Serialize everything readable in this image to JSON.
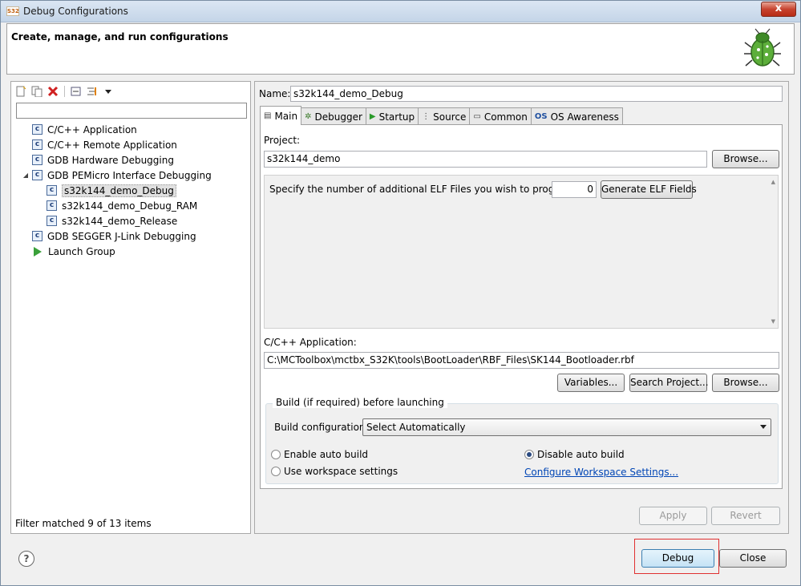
{
  "window": {
    "title": "Debug Configurations",
    "close_glyph": "x"
  },
  "header": {
    "title": "Create, manage, and run configurations"
  },
  "left_panel": {
    "filter_placeholder": "",
    "tree": [
      {
        "label": "C/C++ Application",
        "icon": "c-config-icon",
        "level": 1,
        "expanded": null
      },
      {
        "label": "C/C++ Remote Application",
        "icon": "c-config-icon",
        "level": 1,
        "expanded": null
      },
      {
        "label": "GDB Hardware Debugging",
        "icon": "c-config-icon",
        "level": 1,
        "expanded": null
      },
      {
        "label": "GDB PEMicro Interface Debugging",
        "icon": "c-config-icon",
        "level": 1,
        "expanded": true
      },
      {
        "label": "s32k144_demo_Debug",
        "icon": "c-config-icon",
        "level": 2,
        "selected": true
      },
      {
        "label": "s32k144_demo_Debug_RAM",
        "icon": "c-config-icon",
        "level": 2
      },
      {
        "label": "s32k144_demo_Release",
        "icon": "c-config-icon",
        "level": 2
      },
      {
        "label": "GDB SEGGER J-Link Debugging",
        "icon": "c-config-icon",
        "level": 1
      },
      {
        "label": "Launch Group",
        "icon": "launch-group-icon",
        "level": 1
      }
    ],
    "filter_status": "Filter matched 9 of 13 items"
  },
  "right_panel": {
    "name_label": "Name:",
    "name_value": "s32k144_demo_Debug",
    "tabs": [
      {
        "label": "Main",
        "icon": "main-tab-icon",
        "active": true
      },
      {
        "label": "Debugger",
        "icon": "debugger-tab-icon"
      },
      {
        "label": "Startup",
        "icon": "startup-tab-icon"
      },
      {
        "label": "Source",
        "icon": "source-tab-icon"
      },
      {
        "label": "Common",
        "icon": "common-tab-icon"
      },
      {
        "label": "OS Awareness",
        "icon": "os-awareness-tab-icon"
      }
    ],
    "main": {
      "project_label": "Project:",
      "project_value": "s32k144_demo",
      "browse_label": "Browse...",
      "elf_prompt": "Specify the number of additional ELF Files you wish to program:",
      "elf_count": "0",
      "generate_elf_label": "Generate ELF Fields",
      "app_label": "C/C++ Application:",
      "app_value": "C:\\MCToolbox\\mctbx_S32K\\tools\\BootLoader\\RBF_Files\\SK144_Bootloader.rbf",
      "variables_label": "Variables...",
      "search_project_label": "Search Project...",
      "browse2_label": "Browse...",
      "build_group_title": "Build (if required) before launching",
      "build_config_label": "Build configuration:",
      "build_config_value": "Select Automatically",
      "enable_auto_build": "Enable auto build",
      "disable_auto_build": "Disable auto build",
      "use_workspace": "Use workspace settings",
      "configure_workspace": "Configure Workspace Settings..."
    },
    "apply_label": "Apply",
    "revert_label": "Revert"
  },
  "footer": {
    "help_glyph": "?",
    "debug_label": "Debug",
    "close_label": "Close"
  }
}
